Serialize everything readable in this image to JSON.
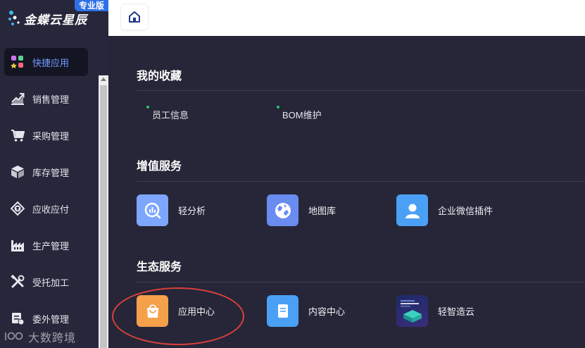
{
  "app": {
    "brand": "金蝶云星辰",
    "edition": "专业版"
  },
  "sidebar": {
    "items": [
      {
        "label": "快捷应用",
        "icon": "app-grid-icon",
        "active": true
      },
      {
        "label": "销售管理",
        "icon": "trend-chart-icon",
        "active": false
      },
      {
        "label": "采购管理",
        "icon": "shopping-cart-icon",
        "active": false
      },
      {
        "label": "库存管理",
        "icon": "box-icon",
        "active": false
      },
      {
        "label": "应收应付",
        "icon": "payment-icon",
        "active": false
      },
      {
        "label": "生产管理",
        "icon": "factory-icon",
        "active": false
      },
      {
        "label": "受托加工",
        "icon": "tools-icon",
        "active": false
      },
      {
        "label": "委外管理",
        "icon": "outsource-icon",
        "active": false
      }
    ]
  },
  "topbar": {
    "home_icon": "home-icon"
  },
  "main": {
    "favorites": {
      "title": "我的收藏",
      "items": [
        "员工信息",
        "BOM维护"
      ]
    },
    "value_added": {
      "title": "增值服务",
      "items": [
        {
          "label": "轻分析",
          "icon": "analysis-icon",
          "color": "#6f9bff"
        },
        {
          "label": "地图库",
          "icon": "map-icon",
          "color": "#5b7cf0"
        },
        {
          "label": "企业微信插件",
          "icon": "user-icon",
          "color": "#4a9bf5"
        }
      ]
    },
    "ecosystem": {
      "title": "生态服务",
      "items": [
        {
          "label": "应用中心",
          "icon": "shopping-bag-icon",
          "color": "#f5a04a"
        },
        {
          "label": "内容中心",
          "icon": "book-icon",
          "color": "#4a9bf5"
        },
        {
          "label": "轻智造云",
          "icon": "cube-stack-icon",
          "color": "#2a3a78"
        }
      ]
    }
  },
  "watermark": {
    "text": "大数跨境"
  },
  "colors": {
    "sidebar_bg": "#26273a",
    "main_bg": "#262638",
    "accent": "#6f9bff",
    "highlight": "#d9403a",
    "edition_badge": "#2d6fe8"
  }
}
